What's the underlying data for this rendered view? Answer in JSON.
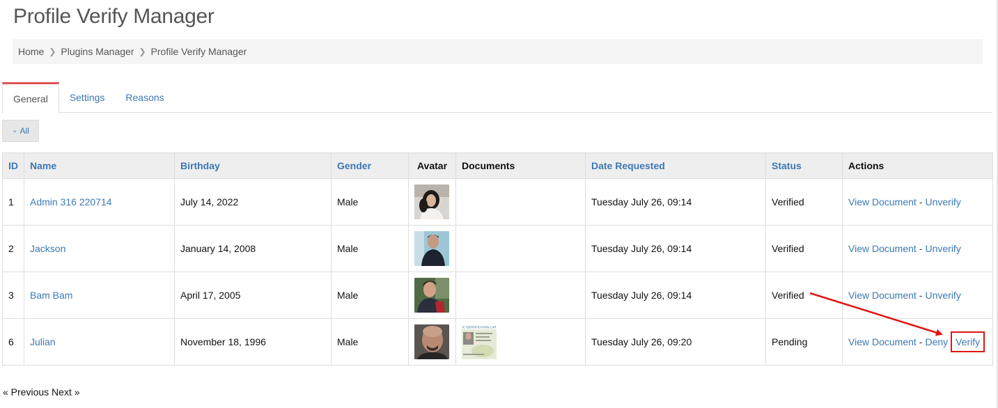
{
  "page": {
    "title": "Profile Verify Manager"
  },
  "breadcrumb": {
    "items": [
      "Home",
      "Plugins Manager",
      "Profile Verify Manager"
    ]
  },
  "tabs": [
    {
      "label": "General",
      "active": true
    },
    {
      "label": "Settings",
      "active": false
    },
    {
      "label": "Reasons",
      "active": false
    }
  ],
  "filter": {
    "label": "All",
    "icon": "chevron-down-icon"
  },
  "table": {
    "headers": {
      "id": "ID",
      "name": "Name",
      "birthday": "Birthday",
      "gender": "Gender",
      "avatar": "Avatar",
      "documents": "Documents",
      "date_requested": "Date Requested",
      "status": "Status",
      "actions": "Actions"
    },
    "rows": [
      {
        "id": "1",
        "name": "Admin 316 220714",
        "birthday": "July 14, 2022",
        "gender": "Male",
        "has_document": false,
        "date_requested": "Tuesday July 26, 09:14",
        "status": "Verified",
        "action_view": "View Document",
        "action_secondary": "Unverify"
      },
      {
        "id": "2",
        "name": "Jackson",
        "birthday": "January 14, 2008",
        "gender": "Male",
        "has_document": false,
        "date_requested": "Tuesday July 26, 09:14",
        "status": "Verified",
        "action_view": "View Document",
        "action_secondary": "Unverify"
      },
      {
        "id": "3",
        "name": "Bam Bam",
        "birthday": "April 17, 2005",
        "gender": "Male",
        "has_document": false,
        "date_requested": "Tuesday July 26, 09:14",
        "status": "Verified",
        "action_view": "View Document",
        "action_secondary": "Unverify"
      },
      {
        "id": "6",
        "name": "Julian",
        "birthday": "November 18, 1996",
        "gender": "Male",
        "has_document": true,
        "date_requested": "Tuesday July 26, 09:20",
        "status": "Pending",
        "action_view": "View Document",
        "action_secondary": "Deny",
        "action_tertiary": "Verify"
      }
    ]
  },
  "pager": {
    "previous": "« Previous",
    "next": "Next »"
  },
  "document_thumb": {
    "header_text": "IC IDENTIFICATION CAR"
  },
  "colors": {
    "link": "#3c78b5",
    "active_tab_accent": "#e05252",
    "annotation_red": "#e01515"
  }
}
